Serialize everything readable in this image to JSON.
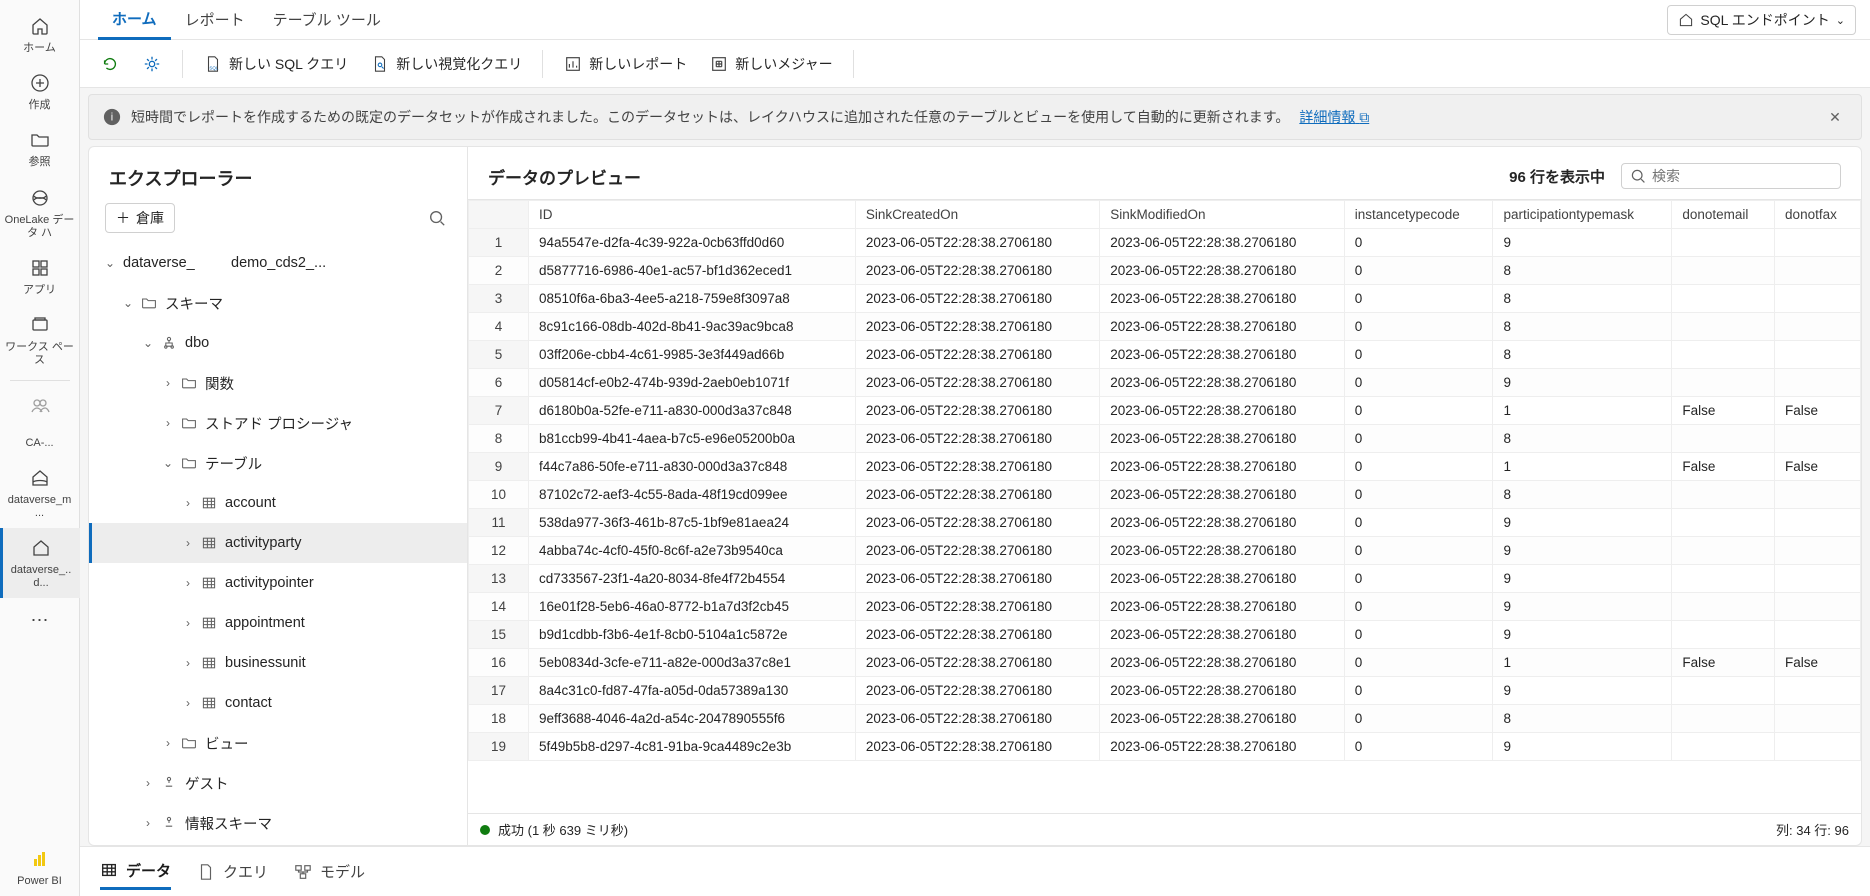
{
  "rail": {
    "home": "ホーム",
    "create": "作成",
    "browse": "参照",
    "onelake": "OneLake データ ハ",
    "apps": "アプリ",
    "workspaces": "ワークス ペース",
    "ca": "CA-...",
    "dvm": "dataverse_m ...",
    "dv": "dataverse_.. d...",
    "powerbi": "Power BI"
  },
  "tabs": {
    "home": "ホーム",
    "report": "レポート",
    "tabletools": "テーブル ツール"
  },
  "endpoint": "SQL エンドポイント",
  "toolbar": {
    "newsql": "新しい SQL クエリ",
    "newvis": "新しい視覚化クエリ",
    "newreport": "新しいレポート",
    "newmeasure": "新しいメジャー"
  },
  "info": {
    "text": "短時間でレポートを作成するための既定のデータセットが作成されました。このデータセットは、レイクハウスに追加された任意のテーブルとビューを使用して自動的に更新されます。",
    "link": "詳細情報"
  },
  "explorer": {
    "title": "エクスプローラー",
    "warehouse": "倉庫",
    "root_a": "dataverse_",
    "root_b": "demo_cds2_...",
    "schema": "スキーマ",
    "dbo": "dbo",
    "functions": "関数",
    "sprocs": "ストアド プロシージャ",
    "tables": "テーブル",
    "views": "ビュー",
    "guest": "ゲスト",
    "infoschema": "情報スキーマ",
    "t": {
      "account": "account",
      "activityparty": "activityparty",
      "activitypointer": "activitypointer",
      "appointment": "appointment",
      "businessunit": "businessunit",
      "contact": "contact"
    }
  },
  "preview": {
    "title": "データのプレビュー",
    "count": "96 行を表示中",
    "search_ph": "検索",
    "status_ok": "成功",
    "status_time": "(1 秒 639 ミリ秒)",
    "cols_rows": "列: 34 行: 96",
    "headers": [
      "ID",
      "SinkCreatedOn",
      "SinkModifiedOn",
      "instancetypecode",
      "participationtypemask",
      "donotemail",
      "donotfax"
    ],
    "rows": [
      {
        "n": "1",
        "id": "94a5547e-d2fa-4c39-922a-0cb63ffd0d60",
        "c": "2023-06-05T22:28:38.2706180",
        "m": "2023-06-05T22:28:38.2706180",
        "i": "0",
        "p": "9",
        "de": "",
        "df": ""
      },
      {
        "n": "2",
        "id": "d5877716-6986-40e1-ac57-bf1d362eced1",
        "c": "2023-06-05T22:28:38.2706180",
        "m": "2023-06-05T22:28:38.2706180",
        "i": "0",
        "p": "8",
        "de": "",
        "df": ""
      },
      {
        "n": "3",
        "id": "08510f6a-6ba3-4ee5-a218-759e8f3097a8",
        "c": "2023-06-05T22:28:38.2706180",
        "m": "2023-06-05T22:28:38.2706180",
        "i": "0",
        "p": "8",
        "de": "",
        "df": ""
      },
      {
        "n": "4",
        "id": "8c91c166-08db-402d-8b41-9ac39ac9bca8",
        "c": "2023-06-05T22:28:38.2706180",
        "m": "2023-06-05T22:28:38.2706180",
        "i": "0",
        "p": "8",
        "de": "",
        "df": ""
      },
      {
        "n": "5",
        "id": "03ff206e-cbb4-4c61-9985-3e3f449ad66b",
        "c": "2023-06-05T22:28:38.2706180",
        "m": "2023-06-05T22:28:38.2706180",
        "i": "0",
        "p": "8",
        "de": "",
        "df": ""
      },
      {
        "n": "6",
        "id": "d05814cf-e0b2-474b-939d-2aeb0eb1071f",
        "c": "2023-06-05T22:28:38.2706180",
        "m": "2023-06-05T22:28:38.2706180",
        "i": "0",
        "p": "9",
        "de": "",
        "df": ""
      },
      {
        "n": "7",
        "id": "d6180b0a-52fe-e711-a830-000d3a37c848",
        "c": "2023-06-05T22:28:38.2706180",
        "m": "2023-06-05T22:28:38.2706180",
        "i": "0",
        "p": "1",
        "de": "False",
        "df": "False"
      },
      {
        "n": "8",
        "id": "b81ccb99-4b41-4aea-b7c5-e96e05200b0a",
        "c": "2023-06-05T22:28:38.2706180",
        "m": "2023-06-05T22:28:38.2706180",
        "i": "0",
        "p": "8",
        "de": "",
        "df": ""
      },
      {
        "n": "9",
        "id": "f44c7a86-50fe-e711-a830-000d3a37c848",
        "c": "2023-06-05T22:28:38.2706180",
        "m": "2023-06-05T22:28:38.2706180",
        "i": "0",
        "p": "1",
        "de": "False",
        "df": "False"
      },
      {
        "n": "10",
        "id": "87102c72-aef3-4c55-8ada-48f19cd099ee",
        "c": "2023-06-05T22:28:38.2706180",
        "m": "2023-06-05T22:28:38.2706180",
        "i": "0",
        "p": "8",
        "de": "",
        "df": ""
      },
      {
        "n": "11",
        "id": "538da977-36f3-461b-87c5-1bf9e81aea24",
        "c": "2023-06-05T22:28:38.2706180",
        "m": "2023-06-05T22:28:38.2706180",
        "i": "0",
        "p": "9",
        "de": "",
        "df": ""
      },
      {
        "n": "12",
        "id": "4abba74c-4cf0-45f0-8c6f-a2e73b9540ca",
        "c": "2023-06-05T22:28:38.2706180",
        "m": "2023-06-05T22:28:38.2706180",
        "i": "0",
        "p": "9",
        "de": "",
        "df": ""
      },
      {
        "n": "13",
        "id": "cd733567-23f1-4a20-8034-8fe4f72b4554",
        "c": "2023-06-05T22:28:38.2706180",
        "m": "2023-06-05T22:28:38.2706180",
        "i": "0",
        "p": "9",
        "de": "",
        "df": ""
      },
      {
        "n": "14",
        "id": "16e01f28-5eb6-46a0-8772-b1a7d3f2cb45",
        "c": "2023-06-05T22:28:38.2706180",
        "m": "2023-06-05T22:28:38.2706180",
        "i": "0",
        "p": "9",
        "de": "",
        "df": ""
      },
      {
        "n": "15",
        "id": "b9d1cdbb-f3b6-4e1f-8cb0-5104a1c5872e",
        "c": "2023-06-05T22:28:38.2706180",
        "m": "2023-06-05T22:28:38.2706180",
        "i": "0",
        "p": "9",
        "de": "",
        "df": ""
      },
      {
        "n": "16",
        "id": "5eb0834d-3cfe-e711-a82e-000d3a37c8e1",
        "c": "2023-06-05T22:28:38.2706180",
        "m": "2023-06-05T22:28:38.2706180",
        "i": "0",
        "p": "1",
        "de": "False",
        "df": "False"
      },
      {
        "n": "17",
        "id": "8a4c31c0-fd87-47fa-a05d-0da57389a130",
        "c": "2023-06-05T22:28:38.2706180",
        "m": "2023-06-05T22:28:38.2706180",
        "i": "0",
        "p": "9",
        "de": "",
        "df": ""
      },
      {
        "n": "18",
        "id": "9eff3688-4046-4a2d-a54c-2047890555f6",
        "c": "2023-06-05T22:28:38.2706180",
        "m": "2023-06-05T22:28:38.2706180",
        "i": "0",
        "p": "8",
        "de": "",
        "df": ""
      },
      {
        "n": "19",
        "id": "5f49b5b8-d297-4c81-91ba-9ca4489c2e3b",
        "c": "2023-06-05T22:28:38.2706180",
        "m": "2023-06-05T22:28:38.2706180",
        "i": "0",
        "p": "9",
        "de": "",
        "df": ""
      }
    ]
  },
  "btabs": {
    "data": "データ",
    "query": "クエリ",
    "model": "モデル"
  }
}
